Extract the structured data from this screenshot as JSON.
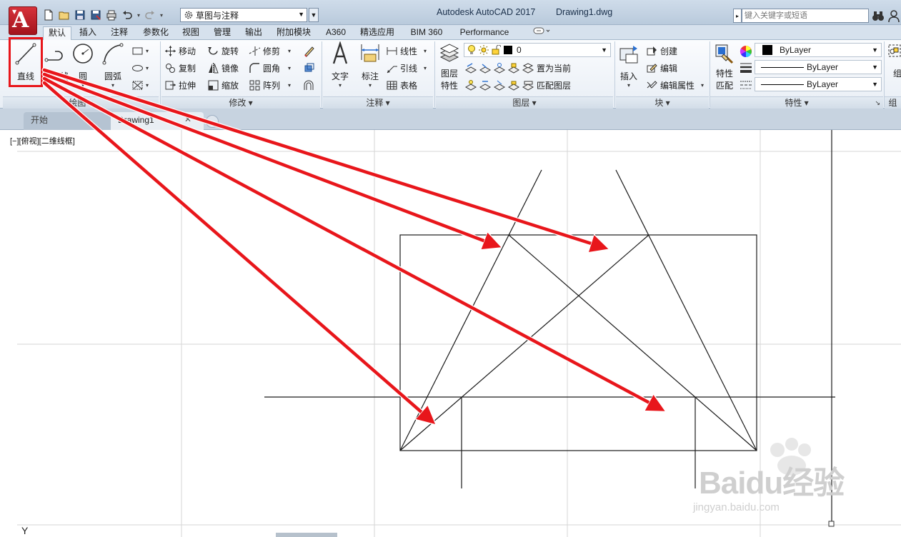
{
  "app": {
    "title": "Autodesk AutoCAD 2017",
    "document": "Drawing1.dwg",
    "logo_letter": "A"
  },
  "workspace": {
    "value": "草图与注释"
  },
  "search": {
    "placeholder": "键入关键字或短语"
  },
  "ribbon_tabs": [
    "默认",
    "插入",
    "注释",
    "参数化",
    "视图",
    "管理",
    "输出",
    "附加模块",
    "A360",
    "精选应用",
    "BIM 360",
    "Performance"
  ],
  "draw_panel": {
    "label": "绘图",
    "line": "直线",
    "polyline": "多段线",
    "circle": "圆",
    "arc": "圆弧"
  },
  "modify_panel": {
    "label": "修改",
    "move": "移动",
    "rotate": "旋转",
    "trim": "修剪",
    "copy": "复制",
    "mirror": "镜像",
    "fillet": "圆角",
    "stretch": "拉伸",
    "scale": "缩放",
    "array": "阵列"
  },
  "annotation_panel": {
    "label": "注释",
    "text": "文字",
    "dimension": "标注",
    "linear": "线性",
    "leader": "引线",
    "table": "表格"
  },
  "layer_panel": {
    "label": "图层",
    "layer_properties_line1": "图层",
    "layer_properties_line2": "特性",
    "current_layer": "0",
    "set_current": "置为当前",
    "match_layer": "匹配图层"
  },
  "block_panel": {
    "label": "块",
    "insert": "插入",
    "create": "创建",
    "edit": "编辑",
    "edit_attributes": "编辑属性"
  },
  "properties_panel": {
    "label": "特性",
    "match_line1": "特性",
    "match_line2": "匹配",
    "color": "ByLayer",
    "linetype": "ByLayer",
    "lineweight": "ByLayer"
  },
  "group_panel": {
    "label_partial": "组"
  },
  "doc_tabs": {
    "start": "开始",
    "drawing": "Drawing1"
  },
  "viewport": {
    "label": "[−][俯视][二维线框]",
    "ucs_y": "Y"
  },
  "watermark": {
    "brand": "Baidu经验",
    "url": "jingyan.baidu.com"
  },
  "colors": {
    "accent_red": "#e8161b",
    "ribbon_bg": "#e8eef5",
    "title_bg": "#c4d3e3"
  }
}
